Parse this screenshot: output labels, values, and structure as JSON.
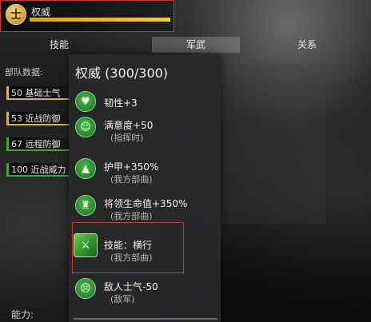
{
  "header": {
    "emblem_char": "士",
    "title": "权威",
    "progress": 1.0
  },
  "tabs": [
    {
      "label": "技能"
    },
    {
      "label": "军武"
    },
    {
      "label": "关系"
    }
  ],
  "troops": {
    "label": "部队数据:",
    "rows": [
      {
        "text": "50 基础士气"
      },
      {
        "text": "53 近战防御"
      },
      {
        "text": "67 远程防御"
      },
      {
        "text": "100 近战威力"
      }
    ]
  },
  "ability_label": "能力:",
  "tooltip": {
    "title": "权威 (300/300)",
    "effects": [
      {
        "icon": "heart-plus-icon",
        "main": "韧性+3",
        "sub": ""
      },
      {
        "icon": "person-icon",
        "main": "满意度+50",
        "sub": "(指挥时)"
      },
      {
        "icon": "armor-up-icon",
        "main": "护甲+350%",
        "sub": "(我方部曲)"
      },
      {
        "icon": "general-icon",
        "main": "将领生命值+350%",
        "sub": "(我方部曲)"
      },
      {
        "icon": "sword-slash-icon",
        "main": "技能：横行",
        "sub": "(我方部曲)"
      },
      {
        "icon": "morale-down-icon",
        "main": "敌人士气-50",
        "sub": "(敌军)"
      }
    ]
  },
  "colors": {
    "accent_gold": "#d4a526",
    "effect_green": "#2a8a2e",
    "highlight_red": "#c43a2c"
  }
}
